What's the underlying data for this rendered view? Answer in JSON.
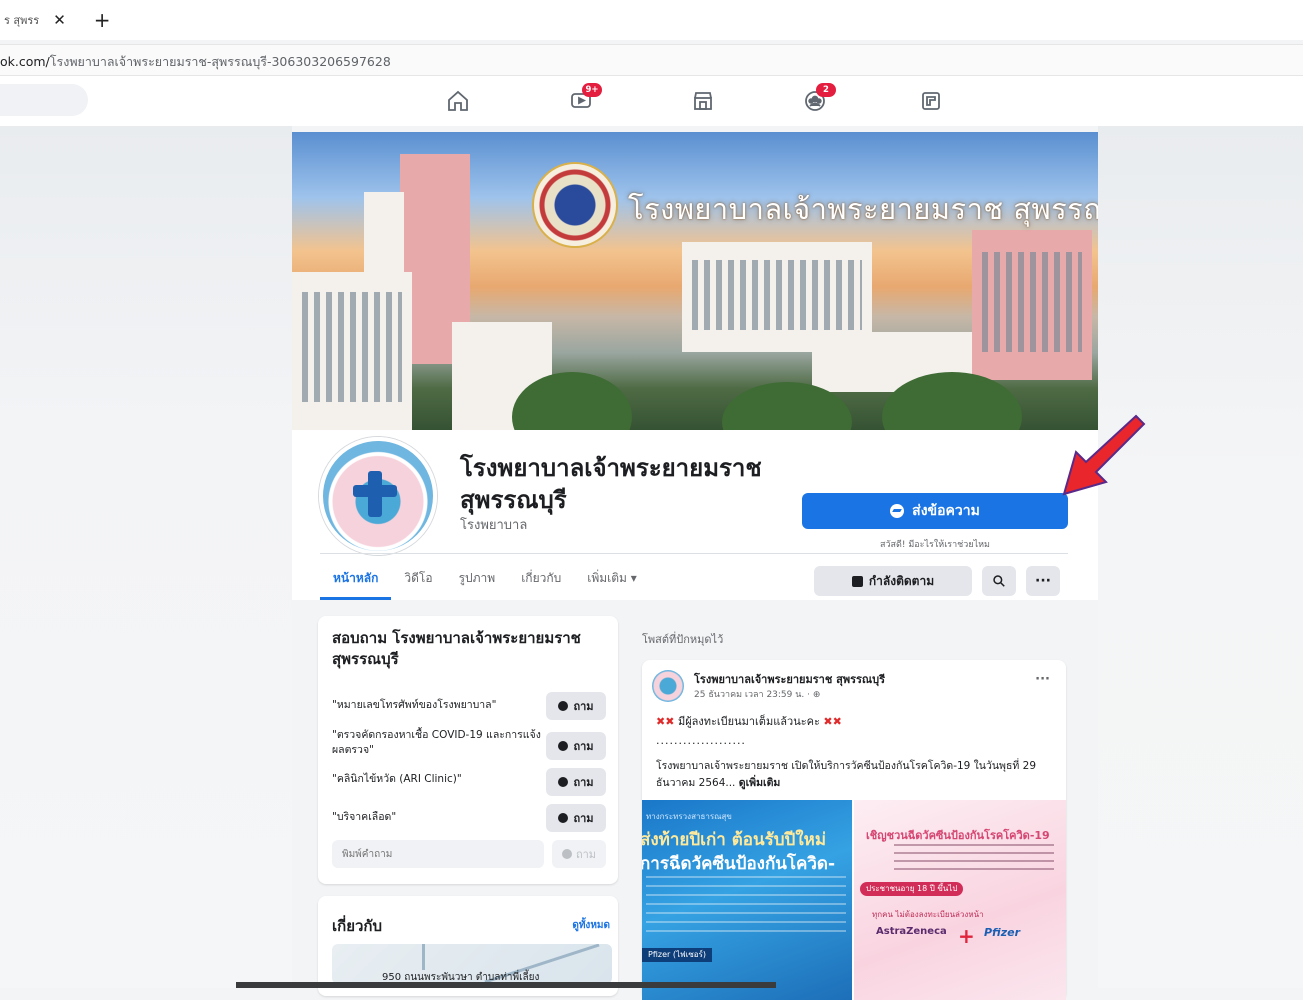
{
  "browser": {
    "tab_title": "ร สุพรร",
    "tab_close": "✕",
    "new_tab": "+",
    "url_host": "ok.com/",
    "url_path": "โรงพยาบาลเจ้าพระยายมราช-สุพรรณบุรี-306303206597628"
  },
  "fbnav": {
    "icons": [
      {
        "name": "home-icon"
      },
      {
        "name": "watch-icon",
        "badge": "9+"
      },
      {
        "name": "marketplace-icon"
      },
      {
        "name": "groups-icon",
        "badge": "2"
      },
      {
        "name": "gaming-icon"
      }
    ]
  },
  "cover": {
    "title": "โรงพยาบาลเจ้าพระยายมราช สุพรรณบุรี"
  },
  "page": {
    "name_line1": "โรงพยาบาลเจ้าพระยายมราช",
    "name_line2": "สุพรรณบุรี",
    "category": "โรงพยาบาล",
    "message_button": "ส่งข้อความ",
    "message_sub": "สวัสดี! มีอะไรให้เราช่วยไหม",
    "follow_button": "กำลังติดตาม",
    "search_icon": "🔍",
    "more": "···"
  },
  "tabs": [
    {
      "label": "หน้าหลัก",
      "active": true
    },
    {
      "label": "วิดีโอ"
    },
    {
      "label": "รูปภาพ"
    },
    {
      "label": "เกี่ยวกับ"
    },
    {
      "label": "เพิ่มเติม ▾"
    }
  ],
  "ask": {
    "title": "สอบถาม โรงพยาบาลเจ้าพระยายมราช สุพรรณบุรี",
    "questions": [
      {
        "text": "\"หมายเลขโทรศัพท์ของโรงพยาบาล\"",
        "button": "ถาม"
      },
      {
        "text": "\"ตรวจคัดกรองหาเชื้อ COVID-19 และการแจ้งผลตรวจ\"",
        "button": "ถาม"
      },
      {
        "text": "\"คลินิกไข้หวัด (ARI Clinic)\"",
        "button": "ถาม"
      },
      {
        "text": "\"บริจาคเลือด\"",
        "button": "ถาม"
      }
    ],
    "input_placeholder": "พิมพ์คำถาม",
    "send_button": "ถาม"
  },
  "about": {
    "title": "เกี่ยวกับ",
    "see_all": "ดูทั้งหมด",
    "address": "950 ถนนพระพันวษา ตำบลท่าพี่เลี้ยง"
  },
  "pinned": {
    "label": "โพสต์ที่ปักหมุดไว้",
    "author": "โรงพยาบาลเจ้าพระยายมราช สุพรรณบุรี",
    "time": "25 ธันวาคม เวลา 23:59 น. · ⊕",
    "more": "···",
    "line1_text": "มีผู้ลงทะเบียนมาเต็มแล้วนะคะ",
    "x_mark": "✖✖",
    "dots": "....................",
    "body": "โรงพยาบาลเจ้าพระยายมราช เปิดให้บริการวัคซีนป้องกันโรคโควิด-19  ในวันพุธที่ 29 ธันวาคม 2564...",
    "see_more": "ดูเพิ่มเติม",
    "img1": {
      "small": "ทางกระทรวงสาธารณสุข",
      "line1": "ส่งท้ายปีเก่า ต้อนรับปีใหม่",
      "line2": "การฉีดวัคซีนป้องกันโควิด-",
      "tag": "Pfizer (ไฟเซอร์)"
    },
    "img2": {
      "title": "เชิญชวนฉีดวัคซีนป้องกันโรคโควิด-19",
      "pill": "ประชาชนอายุ 18 ปี ขึ้นไป",
      "sub": "ทุกคน ไม่ต้องลงทะเบียนล่วงหน้า",
      "az": "AstraZeneca",
      "plus": "+",
      "pfizer": "Pfizer"
    }
  }
}
